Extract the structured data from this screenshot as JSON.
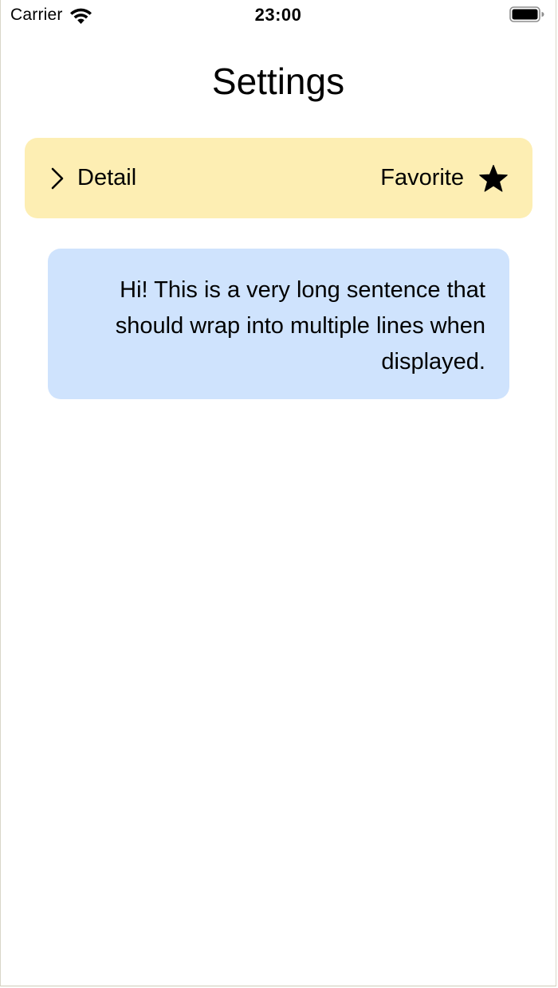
{
  "status_bar": {
    "carrier": "Carrier",
    "time": "23:00",
    "wifi_icon": "wifi-icon",
    "battery_icon": "battery-icon"
  },
  "header": {
    "title": "Settings"
  },
  "detail_row": {
    "background": "#fdeeb3",
    "chevron_icon": "chevron-right-icon",
    "detail_label": "Detail",
    "favorite_label": "Favorite",
    "star_icon": "star-icon"
  },
  "message_card": {
    "background": "#cfe3fd",
    "text": "Hi! This is a very long sentence that should wrap into multiple lines when displayed."
  }
}
